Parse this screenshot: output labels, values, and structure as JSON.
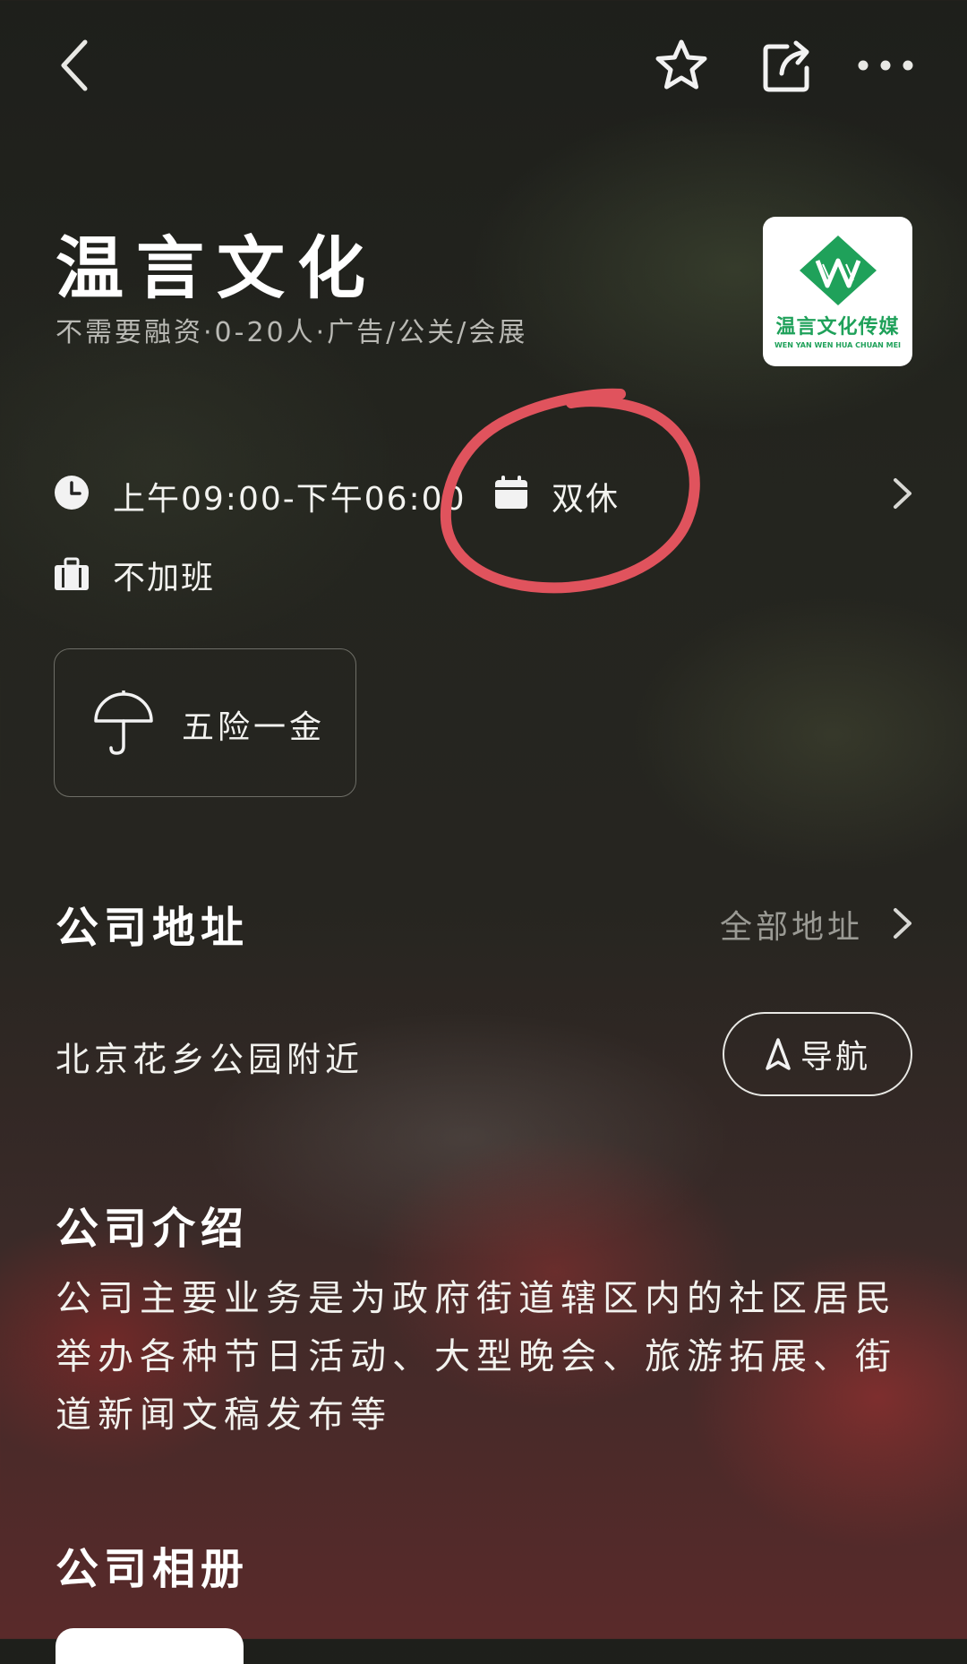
{
  "header": {
    "company_name": "温言文化",
    "company_meta": "不需要融资·0-20人·广告/公关/会展",
    "logo": {
      "text_cn": "温言文化传媒",
      "text_en": "WEN YAN WEN HUA CHUAN MEI"
    }
  },
  "work_info": {
    "hours": "上午09:00-下午06:00",
    "rest": "双休",
    "overtime": "不加班"
  },
  "welfare": {
    "items": [
      "五险一金"
    ]
  },
  "address": {
    "title": "公司地址",
    "all_label": "全部地址",
    "location": "北京花乡公园附近",
    "nav_label": "导航"
  },
  "intro": {
    "title": "公司介绍",
    "text": "公司主要业务是为政府街道辖区内的社区居民举办各种节日活动、大型晚会、旅游拓展、街道新闻文稿发布等"
  },
  "album": {
    "title": "公司相册"
  },
  "colors": {
    "annotation_circle": "#e0535d",
    "logo_green": "#1fa15a"
  },
  "icons": [
    "back-arrow-icon",
    "star-icon",
    "share-icon",
    "more-dots-icon",
    "clock-icon",
    "calendar-icon",
    "chevron-right-icon",
    "briefcase-icon",
    "umbrella-icon",
    "navigate-arrow-icon"
  ]
}
